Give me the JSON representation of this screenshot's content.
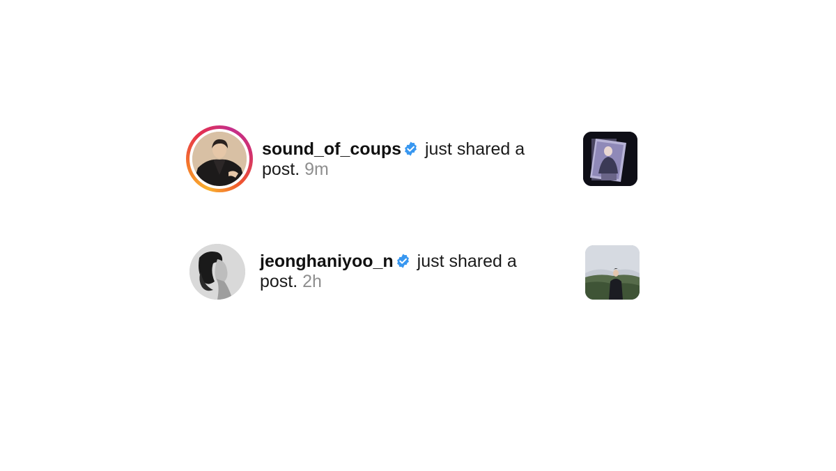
{
  "notifications": [
    {
      "username": "sound_of_coups",
      "verified": true,
      "action": "just shared a post.",
      "time": "9m",
      "has_story_ring": true
    },
    {
      "username": "jeonghaniyoo_n",
      "verified": true,
      "action": "just shared a post.",
      "time": "2h",
      "has_story_ring": false
    }
  ],
  "colors": {
    "verified_badge": "#3897f0",
    "time_text": "#8e8e8e",
    "story_ring_start": "#f9b12f",
    "story_ring_end": "#c42f8b"
  }
}
